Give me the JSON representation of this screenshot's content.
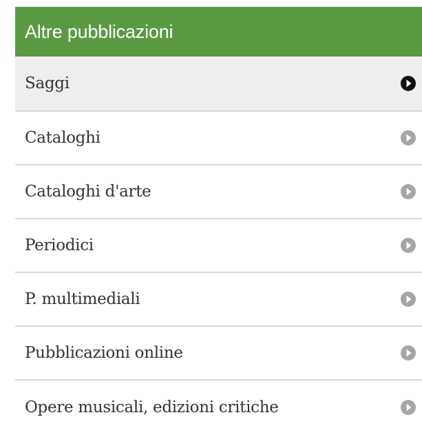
{
  "menu": {
    "title": "Altre pubblicazioni",
    "items": [
      {
        "label": "Saggi",
        "active": true
      },
      {
        "label": "Cataloghi",
        "active": false
      },
      {
        "label": "Cataloghi d'arte",
        "active": false
      },
      {
        "label": "Periodici",
        "active": false
      },
      {
        "label": "P. multimediali",
        "active": false
      },
      {
        "label": "Pubblicazioni online",
        "active": false
      },
      {
        "label": "Opere musicali, edizioni critiche",
        "active": false
      }
    ]
  },
  "colors": {
    "header_bg": "#5a9a42",
    "header_text": "#ffffff",
    "active_bg": "#eeeeee",
    "arrow_active": "#111111",
    "arrow_inactive": "#a6a6a6",
    "divider": "#d9d9d9"
  },
  "icons": {
    "item_arrow": "arrow-circle-right-icon"
  }
}
